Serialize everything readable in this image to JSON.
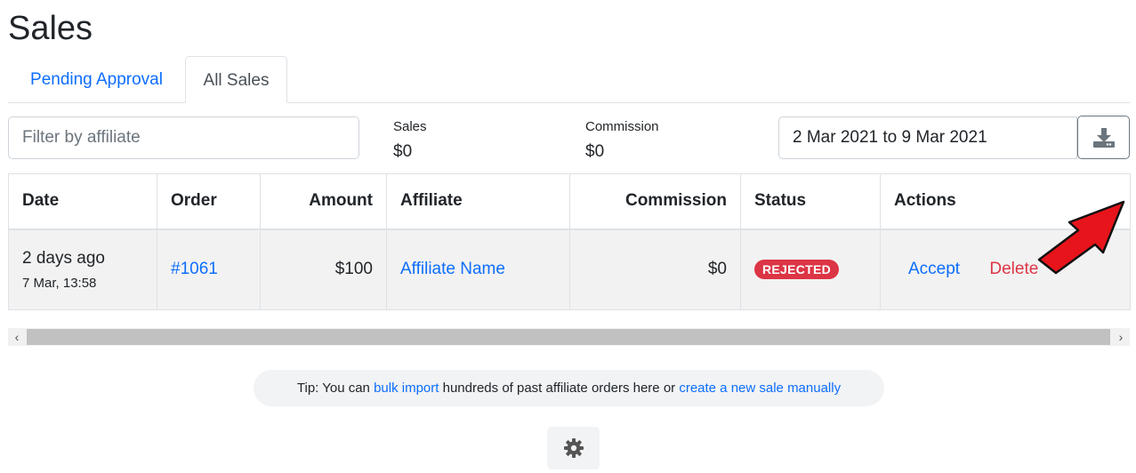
{
  "page": {
    "title": "Sales"
  },
  "tabs": [
    {
      "label": "Pending Approval",
      "active": false
    },
    {
      "label": "All Sales",
      "active": true
    }
  ],
  "filter": {
    "placeholder": "Filter by affiliate",
    "value": ""
  },
  "stats": {
    "sales": {
      "label": "Sales",
      "value": "$0"
    },
    "commission": {
      "label": "Commission",
      "value": "$0"
    }
  },
  "date_range": {
    "value": "2 Mar 2021 to 9 Mar 2021"
  },
  "download": {
    "icon": "download-icon"
  },
  "table": {
    "headers": [
      "Date",
      "Order",
      "Amount",
      "Affiliate",
      "Commission",
      "Status",
      "Actions"
    ],
    "rows": [
      {
        "date_relative": "2 days ago",
        "date_exact": "7 Mar, 13:58",
        "order": "#1061",
        "amount": "$100",
        "affiliate": "Affiliate Name",
        "commission": "$0",
        "status": "REJECTED",
        "actions": {
          "accept": "Accept",
          "delete": "Delete"
        }
      }
    ]
  },
  "scrollbar": {
    "left_icon": "chevron-left-icon",
    "right_icon": "chevron-right-icon"
  },
  "tip": {
    "prefix": "Tip: You can ",
    "link1": "bulk import",
    "middle": " hundreds of past affiliate orders here or ",
    "link2": "create a new sale manually"
  },
  "settings": {
    "icon": "gear-icon"
  },
  "colors": {
    "link": "#0d6efd",
    "danger": "#dc3545",
    "annotation_arrow": "#e8141b"
  }
}
